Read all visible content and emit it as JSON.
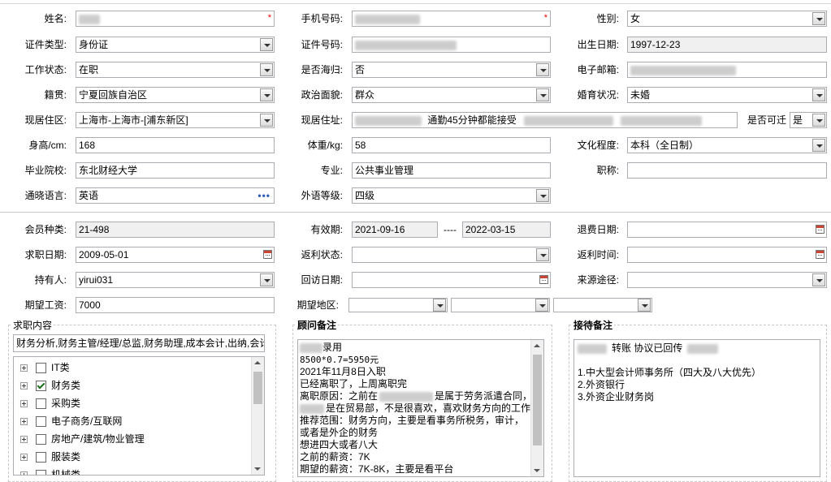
{
  "personal": {
    "name_label": "姓名:",
    "name_value": "",
    "required_mark": "*",
    "phone_label": "手机号码:",
    "phone_value": "",
    "gender_label": "性别:",
    "gender_value": "女",
    "id_type_label": "证件类型:",
    "id_type_value": "身份证",
    "id_no_label": "证件号码:",
    "id_no_value": "",
    "birth_label": "出生日期:",
    "birth_value": "1997-12-23",
    "work_status_label": "工作状态:",
    "work_status_value": "在职",
    "overseas_label": "是否海归:",
    "overseas_value": "否",
    "email_label": "电子邮箱:",
    "email_value": "",
    "native_label": "籍贯:",
    "native_value": "宁夏回族自治区",
    "political_label": "政治面貌:",
    "political_value": "群众",
    "marital_label": "婚育状况:",
    "marital_value": "未婚",
    "region_label": "现居住区:",
    "region_value": "上海市-上海市-[浦东新区]",
    "address_label": "现居住址:",
    "address_value": "通勤45分钟都能接受",
    "relocate_label": "是否可迁",
    "relocate_value": "是",
    "height_label": "身高/cm:",
    "height_value": "168",
    "weight_label": "体重/kg:",
    "weight_value": "58",
    "education_label": "文化程度:",
    "education_value": "本科（全日制）",
    "school_label": "毕业院校:",
    "school_value": "东北财经大学",
    "major_label": "专业:",
    "major_value": "公共事业管理",
    "title_label": "职称:",
    "title_value": "",
    "language_label": "通晓语言:",
    "language_value": "英语",
    "language_more": "•••",
    "language_level_label": "外语等级:",
    "language_level_value": "四级"
  },
  "membership": {
    "member_type_label": "会员种类:",
    "member_type_value": "21-498",
    "valid_label": "有效期:",
    "valid_from": "2021-09-16",
    "valid_sep": "----",
    "valid_to": "2022-03-15",
    "refund_date_label": "退费日期:",
    "refund_date_value": "",
    "apply_date_label": "求职日期:",
    "apply_date_value": "2009-05-01",
    "rebate_status_label": "返利状态:",
    "rebate_status_value": "",
    "rebate_time_label": "返利时间:",
    "rebate_time_value": "",
    "holder_label": "持有人:",
    "holder_value": "yirui031",
    "visit_date_label": "回访日期:",
    "visit_date_value": "",
    "source_label": "来源途径:",
    "source_value": "",
    "salary_label": "期望工资:",
    "salary_value": "7000",
    "area_label": "期望地区:"
  },
  "job_content": {
    "legend": "求职内容",
    "summary": "财务分析,财务主管/经理/总监,财务助理,成本会计,出纳,会计",
    "tree": [
      {
        "label": "IT类",
        "checked": false
      },
      {
        "label": "财务类",
        "checked": true
      },
      {
        "label": "采购类",
        "checked": false
      },
      {
        "label": "电子商务/互联网",
        "checked": false
      },
      {
        "label": "房地产/建筑/物业管理",
        "checked": false
      },
      {
        "label": "服装类",
        "checked": false
      },
      {
        "label": "机械类",
        "checked": false
      }
    ]
  },
  "consultant_notes": {
    "legend": "顾问备注",
    "lines": [
      "录用",
      "8500*0.7=5950元",
      "2021年11月8日入职",
      "已经离职了，上周离职完",
      "离职原因：之前在",
      "是在贸易部，不是很喜欢，喜欢财务方向的工作",
      "推荐范围：财务方向，主要是看事务所税务，审计，",
      "或者是外企的财务",
      "想进四大或者八大",
      "之前的薪资：7K",
      "期望的薪资：7K-8K，主要是看平台"
    ],
    "line5_tail": "是属于劳务派遣合同，在"
  },
  "reception_notes": {
    "legend": "接待备注",
    "lines": [
      "转账 协议已回传",
      "",
      "1.中大型会计师事务所（四大及八大优先）",
      "2.外资银行",
      "3.外资企业财务岗"
    ]
  }
}
